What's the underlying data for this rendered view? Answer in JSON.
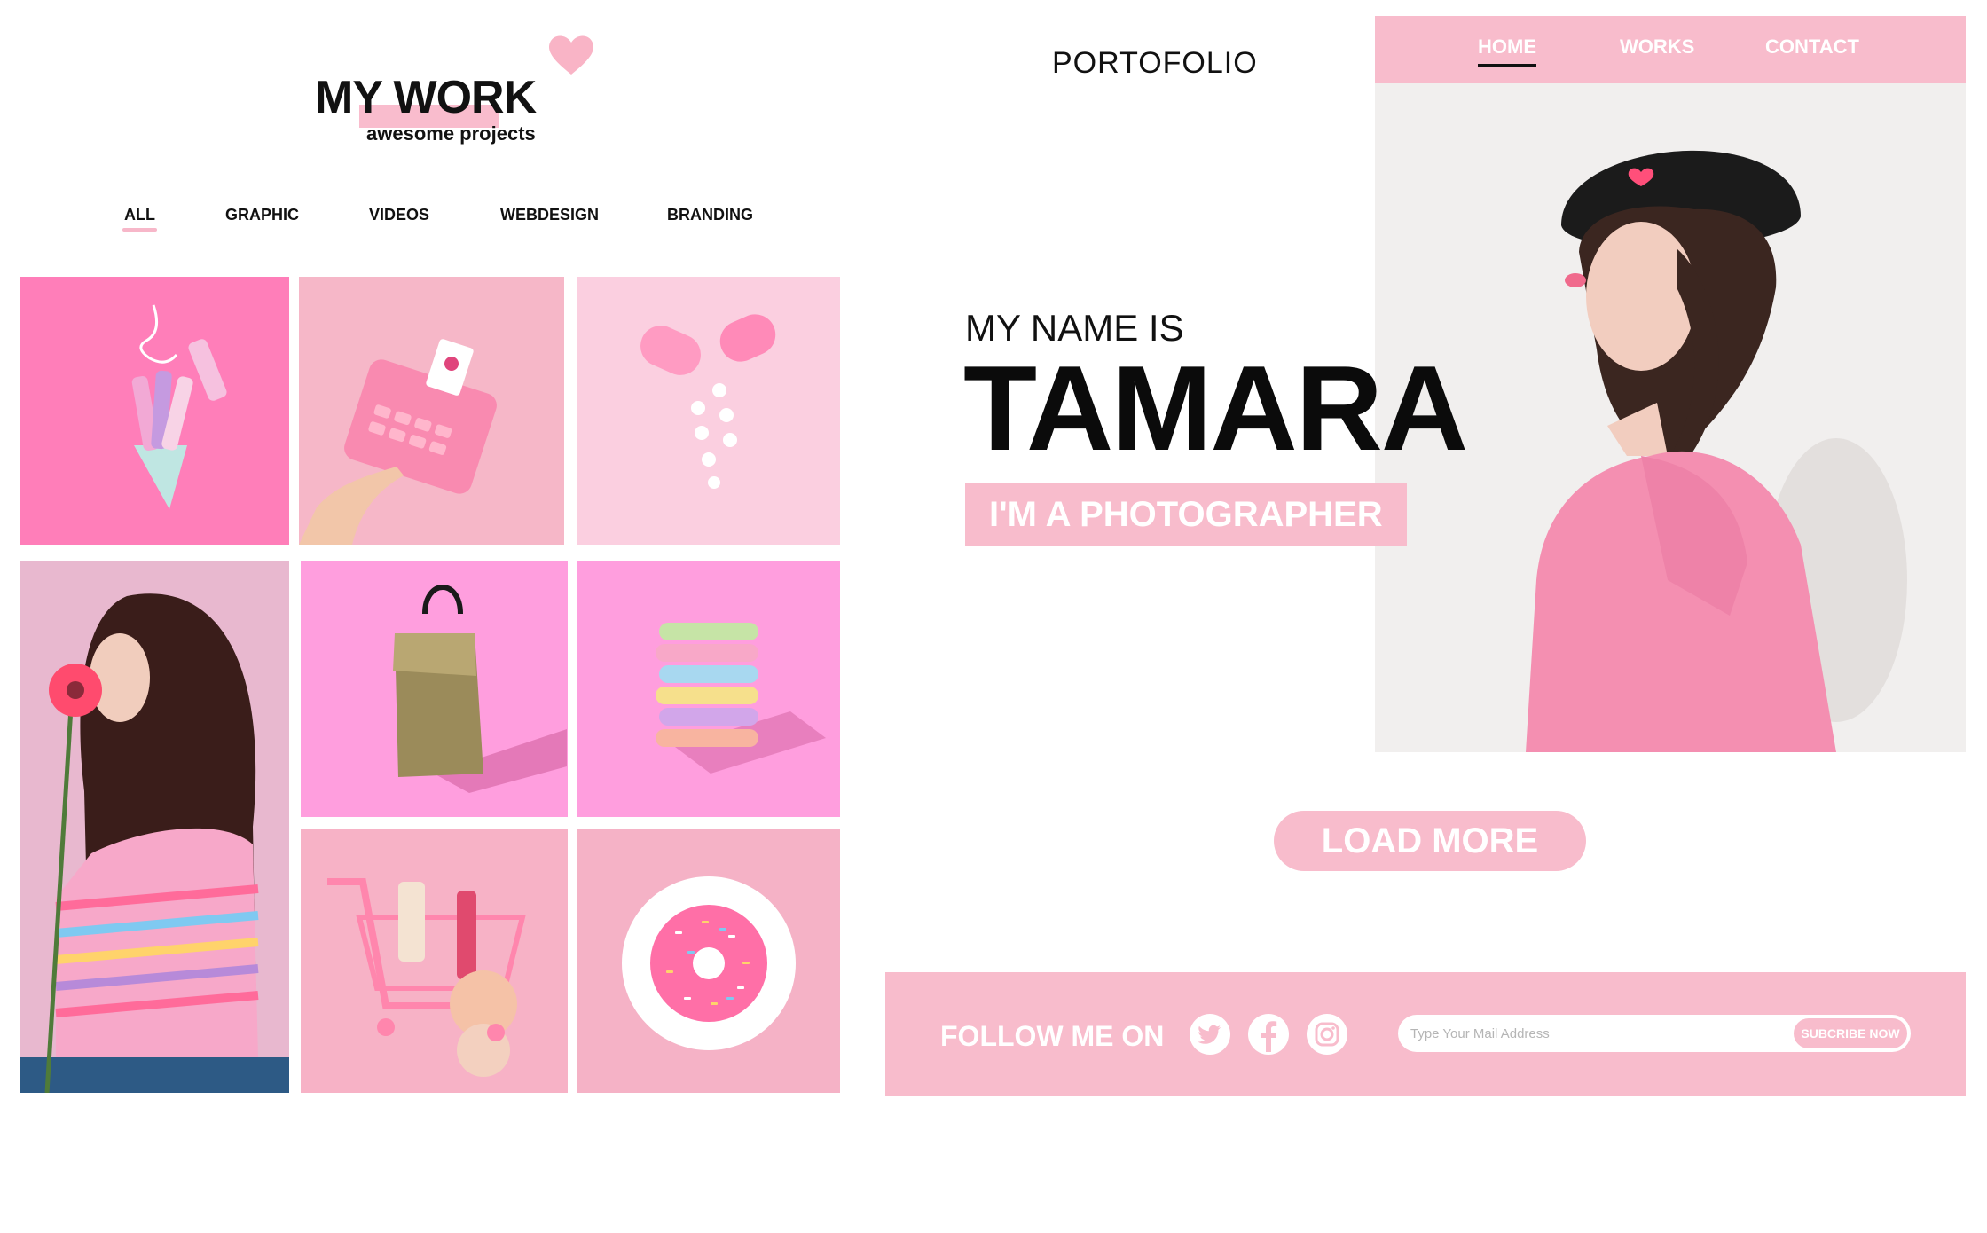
{
  "brand": {
    "accent": "#f8bccc",
    "accent_dark": "#ff7eb9",
    "text": "#111111"
  },
  "work": {
    "title": "MY WORK",
    "subtitle": "awesome projects",
    "logo_icon": "heart-icon",
    "filters": [
      {
        "label": "ALL",
        "active": true
      },
      {
        "label": "GRAPHIC",
        "active": false
      },
      {
        "label": "VIDEOS",
        "active": false
      },
      {
        "label": "WEBDESIGN",
        "active": false
      },
      {
        "label": "BRANDING",
        "active": false
      }
    ],
    "gallery": [
      {
        "subject": "pastel crayons in cone"
      },
      {
        "subject": "pink calculator with hand"
      },
      {
        "subject": "pink capsule with hearts"
      },
      {
        "subject": "girl smelling flower"
      },
      {
        "subject": "tote bag"
      },
      {
        "subject": "stacked chalk"
      },
      {
        "subject": "shopping cart with cosmetics"
      },
      {
        "subject": "pink donut on plate"
      }
    ]
  },
  "hero": {
    "portfolio_label": "PORTOFOLIO",
    "nav": [
      {
        "label": "HOME",
        "active": true
      },
      {
        "label": "WORKS",
        "active": false
      },
      {
        "label": "CONTACT",
        "active": false
      }
    ],
    "name_prefix": "MY NAME IS",
    "name": "TAMARA",
    "role": "I'M A PHOTOGRAPHER",
    "load_more": "LOAD MORE"
  },
  "footer": {
    "follow_label": "FOLLOW ME ON",
    "social": [
      "twitter-icon",
      "facebook-icon",
      "instagram-icon"
    ],
    "email_placeholder": "Type Your Mail Address",
    "subscribe_label": "SUBCRIBE NOW"
  }
}
